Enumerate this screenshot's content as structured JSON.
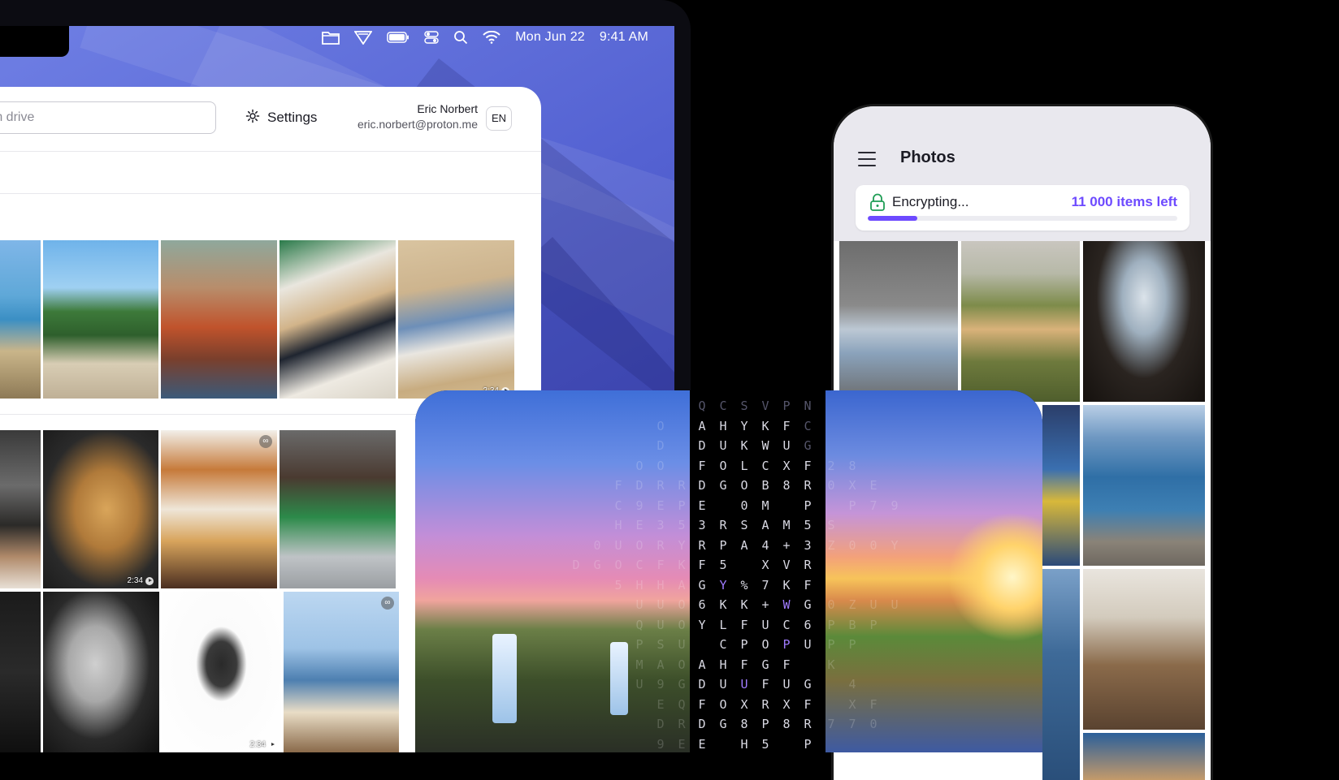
{
  "menubar": {
    "date": "Mon Jun 22",
    "time": "9:41 AM",
    "icons": [
      "folder-icon",
      "proton-vpn-icon",
      "battery-icon",
      "control-center-icon",
      "search-icon",
      "wifi-icon"
    ]
  },
  "drive": {
    "search_placeholder": "rch drive",
    "settings_label": "Settings",
    "user_name": "Eric Norbert",
    "user_email": "eric.norbert@proton.me",
    "language": "EN",
    "video_badges": [
      "2:34",
      "2:34",
      "2:34"
    ]
  },
  "photos": {
    "title": "Photos",
    "encrypting_label": "Encrypting...",
    "items_left": "11 000 items left",
    "progress": 0.16
  },
  "cipher": {
    "left_ghost": [
      [
        "",
        "",
        "",
        "",
        "",
        ""
      ],
      [
        "",
        "",
        "",
        "",
        "",
        "O"
      ],
      [
        "",
        "",
        "",
        "",
        "",
        "D"
      ],
      [
        "",
        "",
        "",
        "",
        "O",
        "O"
      ],
      [
        "",
        "",
        "",
        "F",
        "D",
        "R"
      ],
      [
        "",
        "",
        "",
        "C",
        "9",
        "E"
      ],
      [
        "",
        "",
        "",
        "H",
        "E",
        "3"
      ],
      [
        "",
        "",
        "0",
        "U",
        "O",
        "R"
      ],
      [
        "",
        "D",
        "G",
        "O",
        "C",
        "F"
      ],
      [
        "",
        "",
        "",
        "5",
        "H",
        "H"
      ],
      [
        "",
        "",
        "",
        "",
        "U",
        "U"
      ],
      [
        "",
        "",
        "",
        "",
        "Q",
        "U"
      ],
      [
        "",
        "",
        "",
        "",
        "P",
        "S"
      ],
      [
        "",
        "",
        "",
        "",
        "M",
        "A"
      ],
      [
        "",
        "",
        "",
        "",
        "U",
        "9"
      ],
      [
        "",
        "",
        "",
        "",
        "",
        "E"
      ],
      [
        "",
        "",
        "",
        "",
        "",
        "D"
      ],
      [
        "",
        "",
        "",
        "",
        "",
        "9"
      ]
    ],
    "left_edge": [
      "",
      "",
      "",
      "",
      "R",
      "P",
      "5",
      "Y",
      "K",
      "A",
      "O",
      "O",
      "U",
      "O",
      "G",
      "Q",
      "R",
      "E"
    ],
    "middle": [
      [
        "Q",
        "C",
        "S",
        "V",
        "P",
        "N"
      ],
      [
        "A",
        "H",
        "Y",
        "K",
        "F",
        "C"
      ],
      [
        "D",
        "U",
        "K",
        "W",
        "U",
        "G"
      ],
      [
        "F",
        "O",
        "L",
        "C",
        "X",
        "F"
      ],
      [
        "D",
        "G",
        "O",
        "B",
        "8",
        "R"
      ],
      [
        "E",
        "",
        "0",
        "M",
        "",
        "P"
      ],
      [
        "3",
        "R",
        "S",
        "A",
        "M",
        "5"
      ],
      [
        "R",
        "P",
        "A",
        "4",
        "+",
        "3"
      ],
      [
        "F",
        "5",
        "",
        "X",
        "V",
        "R"
      ],
      [
        "G",
        "Y",
        "%",
        "7",
        "K",
        "F"
      ],
      [
        "6",
        "K",
        "K",
        "+",
        "W",
        "G"
      ],
      [
        "Y",
        "L",
        "F",
        "U",
        "C",
        "6"
      ],
      [
        "",
        "C",
        "P",
        "O",
        "P",
        "U"
      ],
      [
        "A",
        "H",
        "F",
        "G",
        "F",
        ""
      ],
      [
        "D",
        "U",
        "U",
        "F",
        "U",
        "G"
      ],
      [
        "F",
        "O",
        "X",
        "R",
        "X",
        "F"
      ],
      [
        "D",
        "G",
        "8",
        "P",
        "8",
        "R"
      ],
      [
        "E",
        "",
        "H",
        "5",
        "",
        "P"
      ]
    ],
    "right_ghost": [
      [
        "",
        "",
        "",
        ""
      ],
      [
        "",
        "",
        "",
        ""
      ],
      [
        "",
        "",
        "",
        ""
      ],
      [
        "2",
        "8",
        "",
        ""
      ],
      [
        "0",
        "X",
        "E",
        ""
      ],
      [
        "",
        "P",
        "7",
        "9"
      ],
      [
        "S",
        "",
        "",
        ""
      ],
      [
        "Z",
        "0",
        "0",
        "Y"
      ],
      [
        "",
        "",
        "",
        ""
      ],
      [
        "",
        "",
        "",
        ""
      ],
      [
        "0",
        "Z",
        "U",
        "U"
      ],
      [
        "P",
        "B",
        "P",
        ""
      ],
      [
        "P",
        "P",
        "",
        ""
      ],
      [
        "K",
        "",
        "",
        ""
      ],
      [
        "",
        "4",
        "",
        ""
      ],
      [
        "",
        "X",
        "F",
        ""
      ],
      [
        "7",
        "7",
        "0",
        ""
      ],
      [
        "",
        "",
        "",
        ""
      ]
    ]
  }
}
